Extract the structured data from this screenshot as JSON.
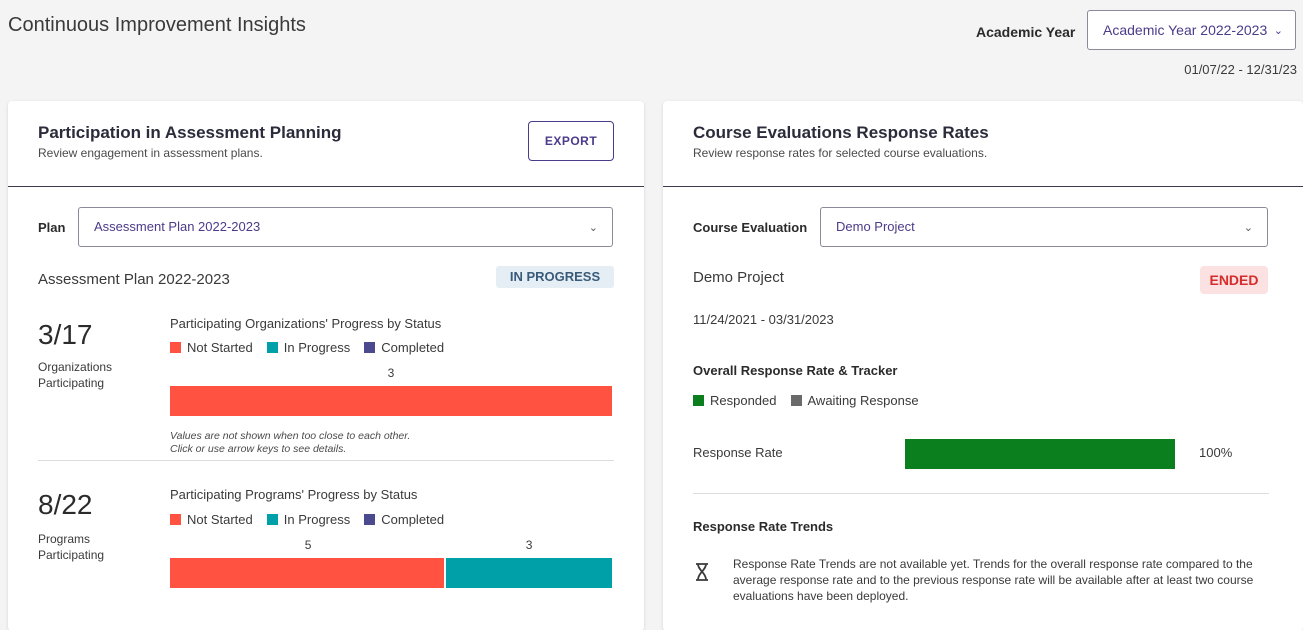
{
  "page": {
    "title": "Continuous Improvement Insights"
  },
  "academic_year": {
    "label": "Academic Year",
    "selected": "Academic Year 2022-2023",
    "date_range": "01/07/22 - 12/31/23"
  },
  "participation": {
    "title": "Participation in Assessment Planning",
    "subtitle": "Review engagement in assessment plans.",
    "export_label": "EXPORT",
    "plan_label": "Plan",
    "plan_selected": "Assessment Plan 2022-2023",
    "plan_name": "Assessment Plan 2022-2023",
    "status_badge": "IN PROGRESS",
    "legend": {
      "not_started": "Not Started",
      "in_progress": "In Progress",
      "completed": "Completed"
    },
    "colors": {
      "not_started": "#ff5240",
      "in_progress": "#00a0a8",
      "completed": "#4b4a8f"
    },
    "orgs": {
      "fraction": "3/17",
      "label": "Organizations Participating",
      "chart_title": "Participating Organizations' Progress by Status",
      "not_started": 3,
      "in_progress": 0,
      "completed": 0,
      "not_started_label": "3",
      "note_line1": "Values are not shown when too close to each other.",
      "note_line2": "Click or use arrow keys to see details."
    },
    "programs": {
      "fraction": "8/22",
      "label": "Programs Participating",
      "chart_title": "Participating Programs' Progress by Status",
      "not_started": 5,
      "in_progress": 3,
      "completed": 0,
      "not_started_label": "5",
      "in_progress_label": "3"
    }
  },
  "course_eval": {
    "title": "Course Evaluations Response Rates",
    "subtitle": "Review response rates for selected course evaluations.",
    "eval_label": "Course Evaluation",
    "eval_selected": "Demo Project",
    "project_name": "Demo Project",
    "status_badge": "ENDED",
    "dates": "11/24/2021 - 03/31/2023",
    "tracker_heading": "Overall Response Rate & Tracker",
    "legend": {
      "responded": "Responded",
      "awaiting": "Awaiting Response"
    },
    "colors": {
      "responded": "#0b7f1e",
      "awaiting": "#6a6a6a"
    },
    "response_rate_label": "Response Rate",
    "response_rate_value": 1.0,
    "response_rate_text": "100%",
    "trends_heading": "Response Rate Trends",
    "trends_message": "Response Rate Trends are not available yet. Trends for the overall response rate compared to the average response rate and to the previous response rate will be available after at least two course evaluations have been deployed."
  }
}
